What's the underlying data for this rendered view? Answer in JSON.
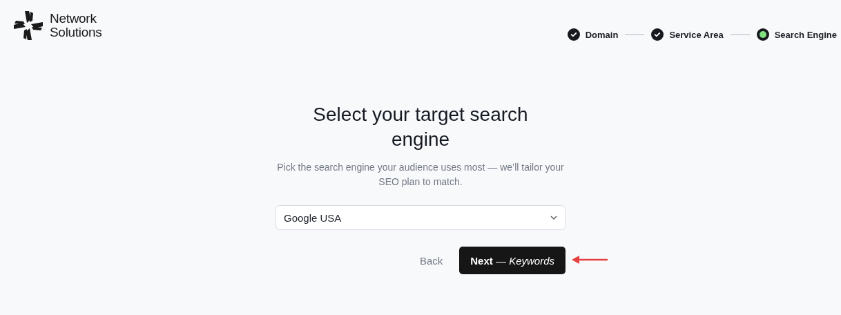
{
  "logo": {
    "line_1": "Network",
    "line_2": "Solutions"
  },
  "steps": [
    {
      "label": "Domain",
      "completed": true
    },
    {
      "label": "Service Area",
      "completed": true
    },
    {
      "label": "Search Engine",
      "completed": false
    }
  ],
  "title": "Select your target search engine",
  "subtitle": "Pick the search engine your audience uses most — we’ll tailor your SEO plan to match.",
  "select": {
    "value": "Google USA"
  },
  "buttons": {
    "back": "Back",
    "next": "**Next** — *Keywords*"
  },
  "annotation": {
    "kind": "arrow"
  }
}
